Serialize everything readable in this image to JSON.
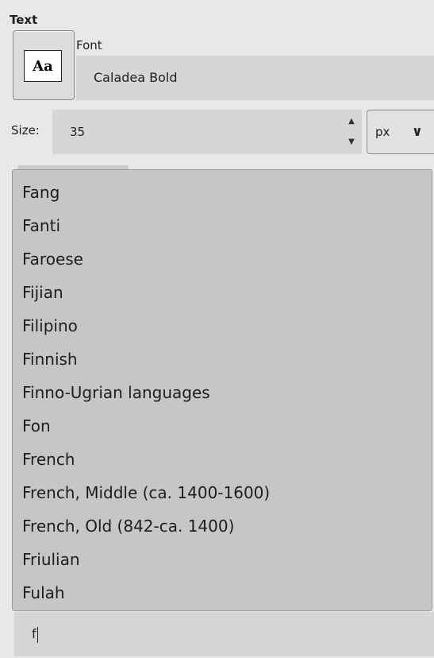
{
  "panel": {
    "title": "Text"
  },
  "font": {
    "label": "Font",
    "preview_text": "Aa",
    "value": "Caladea Bold"
  },
  "size": {
    "label": "Size:",
    "value": "35",
    "spin_up_icon": "spin-up-arrow",
    "spin_down_icon": "spin-down-arrow",
    "unit": "px",
    "unit_icon": "chevron-down-icon"
  },
  "language_list": {
    "items": [
      "Fang",
      "Fanti",
      "Faroese",
      "Fijian",
      "Filipino",
      "Finnish",
      "Finno-Ugrian languages",
      "Fon",
      "French",
      "French, Middle (ca. 1400-1600)",
      "French, Old (842-ca. 1400)",
      "Friulian",
      "Fulah"
    ]
  },
  "search": {
    "value": "f"
  },
  "colors": {
    "background": "#e8e8e8",
    "field": "#d6d6d6",
    "popup": "#c6c6c6"
  }
}
